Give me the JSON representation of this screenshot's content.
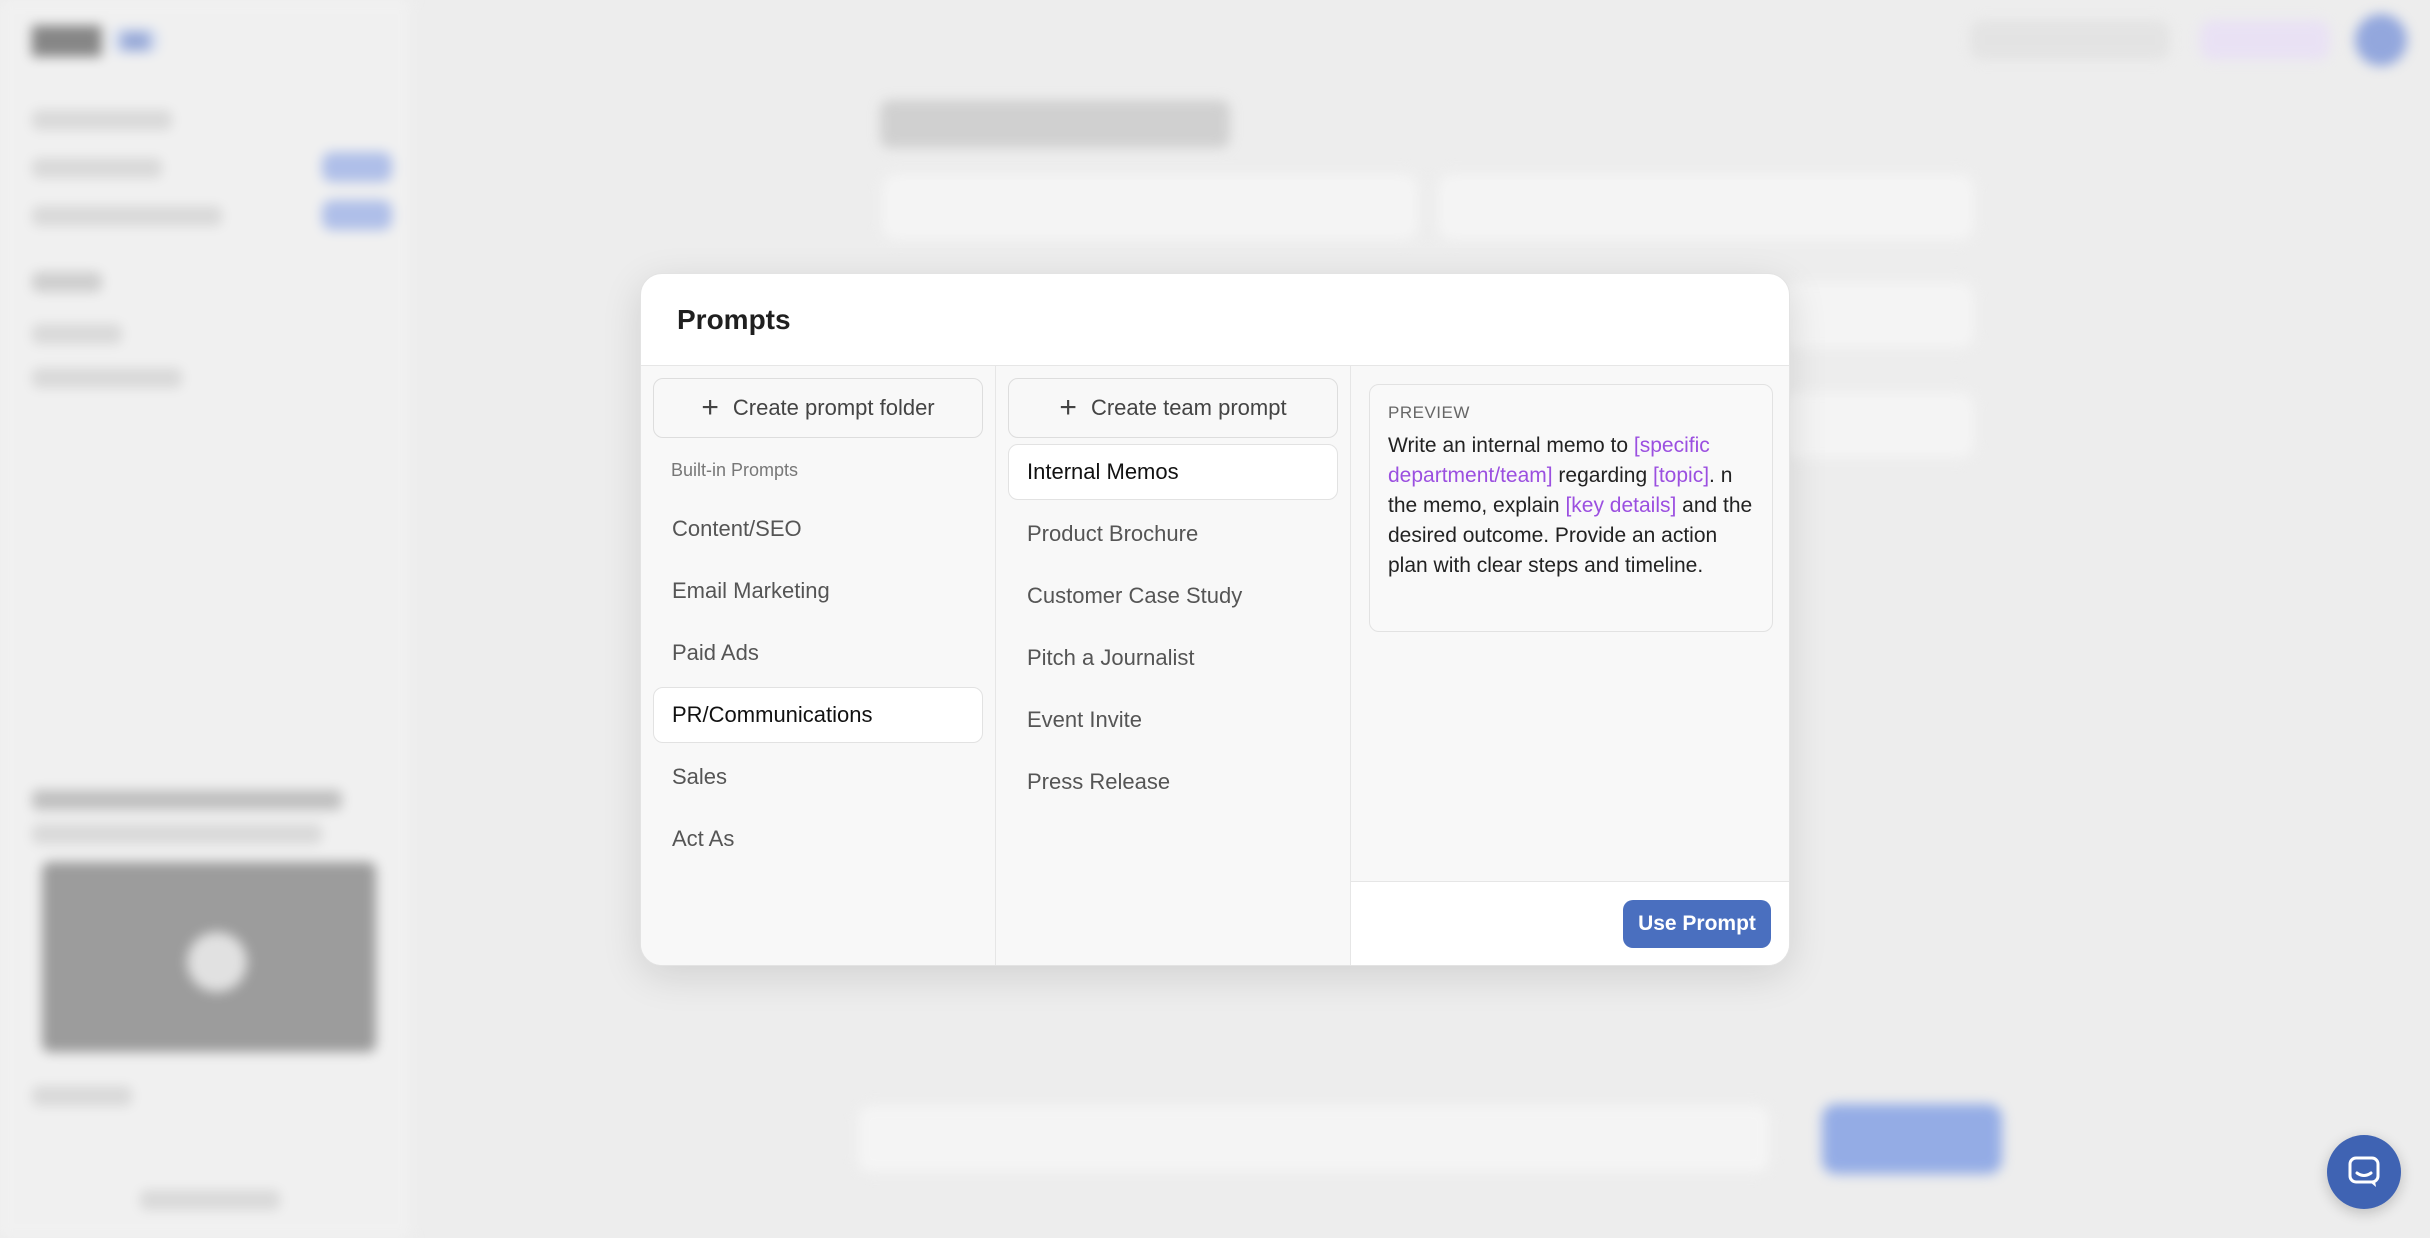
{
  "modal": {
    "title": "Prompts",
    "folders": {
      "create_label": "Create prompt folder",
      "section_label": "Built-in Prompts",
      "items": [
        {
          "label": "Content/SEO",
          "active": false
        },
        {
          "label": "Email Marketing",
          "active": false
        },
        {
          "label": "Paid Ads",
          "active": false
        },
        {
          "label": "PR/Communications",
          "active": true
        },
        {
          "label": "Sales",
          "active": false
        },
        {
          "label": "Act As",
          "active": false
        }
      ]
    },
    "prompts": {
      "create_label": "Create team prompt",
      "items": [
        {
          "label": "Internal Memos",
          "active": true
        },
        {
          "label": "Product Brochure",
          "active": false
        },
        {
          "label": "Customer Case Study",
          "active": false
        },
        {
          "label": "Pitch a Journalist",
          "active": false
        },
        {
          "label": "Event Invite",
          "active": false
        },
        {
          "label": "Press Release",
          "active": false
        }
      ]
    },
    "preview": {
      "label": "PREVIEW",
      "segments": [
        {
          "text": "Write an internal memo to ",
          "var": false
        },
        {
          "text": "[specific department/team]",
          "var": true
        },
        {
          "text": " regarding ",
          "var": false
        },
        {
          "text": "[topic]",
          "var": true
        },
        {
          "text": ". n the memo, explain ",
          "var": false
        },
        {
          "text": "[key details]",
          "var": true
        },
        {
          "text": " and the desired outcome. Provide an action plan with clear steps and timeline.",
          "var": false
        }
      ]
    },
    "use_button_label": "Use Prompt"
  },
  "colors": {
    "accent": "#4a6fbf",
    "variable": "#9b4fe0",
    "chat_launcher": "#3f63b3"
  },
  "icons": {
    "create": "plus-icon",
    "chat": "chat-bubble-icon"
  }
}
